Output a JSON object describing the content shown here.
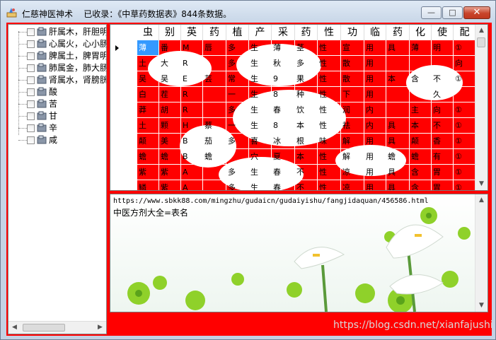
{
  "window": {
    "title": "仁慈神医神术    已收录：《中草药数据表》844条数据。",
    "minimize_glyph": "—",
    "maximize_glyph": "□",
    "close_glyph": "✕"
  },
  "tree": {
    "items": [
      {
        "label": "肝属木，肝胆明"
      },
      {
        "label": "心属火，心小肠"
      },
      {
        "label": "脾属土，脾胃明"
      },
      {
        "label": "肺属金，肺大肠"
      },
      {
        "label": "肾属水，肾膀胱"
      },
      {
        "label": "酸"
      },
      {
        "label": "苦"
      },
      {
        "label": "甘"
      },
      {
        "label": "辛"
      },
      {
        "label": "咸"
      }
    ],
    "scroll_left_glyph": "◀",
    "scroll_right_glyph": "▶"
  },
  "grid": {
    "columns": [
      "虫",
      "别",
      "英",
      "药",
      "植",
      "产",
      "采",
      "药",
      "性",
      "功",
      "临",
      "药",
      "化",
      "使",
      "配"
    ],
    "rows": [
      [
        "薄",
        "番",
        "M",
        "唇",
        "多",
        "生",
        "薄",
        "茎",
        "性",
        "宣",
        "用",
        "具",
        "薄",
        "明",
        "①"
      ],
      [
        "土",
        "大",
        "R",
        "",
        "多",
        "生",
        "秋",
        "多",
        "性",
        "散",
        "用",
        "",
        "",
        "",
        "向"
      ],
      [
        "吴",
        "吴",
        "E",
        "芸",
        "常",
        "生",
        "9",
        "果",
        "性",
        "散",
        "用",
        "本",
        "含",
        "不",
        "①"
      ],
      [
        "白",
        "茬",
        "R",
        "",
        "一",
        "生",
        "8",
        "种",
        "性",
        "下",
        "用",
        "",
        "",
        "久",
        ""
      ],
      [
        "莽",
        "胡",
        "R",
        "",
        "多",
        "生",
        "春",
        "饮",
        "性",
        "润",
        "内",
        "",
        "主",
        "向",
        "①"
      ],
      [
        "土",
        "颗",
        "H",
        "蔡",
        "一",
        "生",
        "8",
        "本",
        "性",
        "祛",
        "内",
        "具",
        "本",
        "不",
        "①"
      ],
      [
        "颠",
        "美",
        "B",
        "茄",
        "多",
        "喜",
        "冰",
        "根",
        "味",
        "解",
        "用",
        "具",
        "颠",
        "香",
        "①"
      ],
      [
        "蟾",
        "蟾",
        "B",
        "蟾",
        "",
        "穴",
        "夏",
        "本",
        "性",
        "解",
        "用",
        "蟾",
        "蟾",
        "有",
        "①"
      ],
      [
        "紫",
        "紫",
        "A",
        "",
        "多",
        "生",
        "春",
        "不",
        "性",
        "凉",
        "用",
        "具",
        "含",
        "胃",
        "①"
      ],
      [
        "鳞",
        "紫",
        "A",
        "",
        "多",
        "生",
        "春",
        "不",
        "性",
        "凉",
        "用",
        "具",
        "含",
        "胃",
        "①"
      ]
    ],
    "scroll_up_glyph": "▲",
    "scroll_down_glyph": "▼"
  },
  "detail": {
    "url": "https://www.sbkk88.com/mingzhu/gudaicn/gudaiyishu/fangjidaquan/456586.html",
    "name": "中医方剂大全=表名",
    "scroll_up_glyph": "▲",
    "scroll_down_glyph": "▼"
  },
  "watermark": "https://blog.csdn.net/xianfajushi",
  "colors": {
    "background_fill": "#ff0000",
    "selection": "#3399ff",
    "close_button": "#c8442b"
  }
}
